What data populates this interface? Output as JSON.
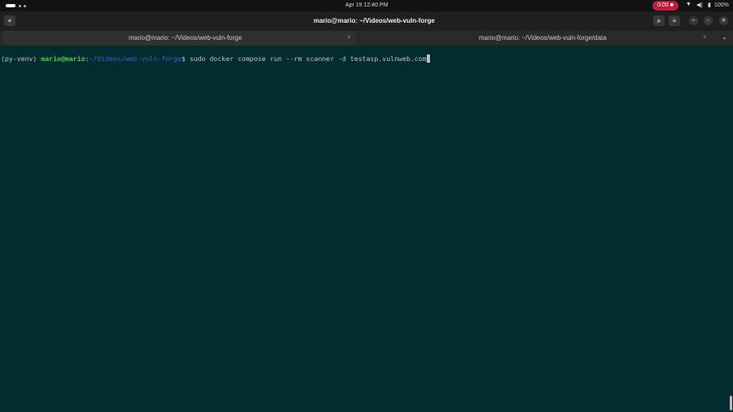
{
  "topbar": {
    "datetime": "Apr 19  12:40 PM",
    "recording": "0:00",
    "battery": "100%"
  },
  "window": {
    "title": "mario@mario: ~/Videos/web-vuln-forge"
  },
  "tabs": [
    {
      "label": "mario@mario: ~/Videos/web-vuln-forge"
    },
    {
      "label": "mario@mario: ~/Videos/web-vuln-forge/data"
    }
  ],
  "terminal": {
    "venv": "(py-venv) ",
    "user": "mario@mario",
    "sep": ":",
    "path": "~/Videos/web-vuln-forge",
    "prompt": "$ ",
    "command": "sudo docker compose run --rm scanner -d testasp.vulnweb.com"
  }
}
